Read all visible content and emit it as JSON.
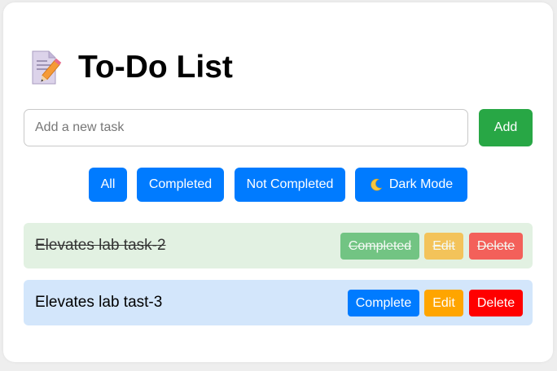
{
  "header": {
    "title": "To-Do List",
    "icon": "memo-icon"
  },
  "input": {
    "placeholder": "Add a new task",
    "value": ""
  },
  "add_button": {
    "label": "Add"
  },
  "filters": {
    "all": "All",
    "completed": "Completed",
    "not_completed": "Not Completed",
    "dark_mode": "Dark Mode",
    "dark_mode_icon": "moon-icon"
  },
  "tasks": [
    {
      "text": "Elevates lab task-2",
      "completed": true,
      "actions": {
        "complete": "Completed",
        "edit": "Edit",
        "delete": "Delete"
      }
    },
    {
      "text": "Elevates lab tast-3",
      "completed": false,
      "actions": {
        "complete": "Complete",
        "edit": "Edit",
        "delete": "Delete"
      }
    }
  ],
  "colors": {
    "add": "#28a745",
    "primary": "#007bff",
    "edit": "#ffa500",
    "delete": "#ff0000",
    "done_row": "#e2f1e2",
    "open_row": "#d3e6fb"
  }
}
